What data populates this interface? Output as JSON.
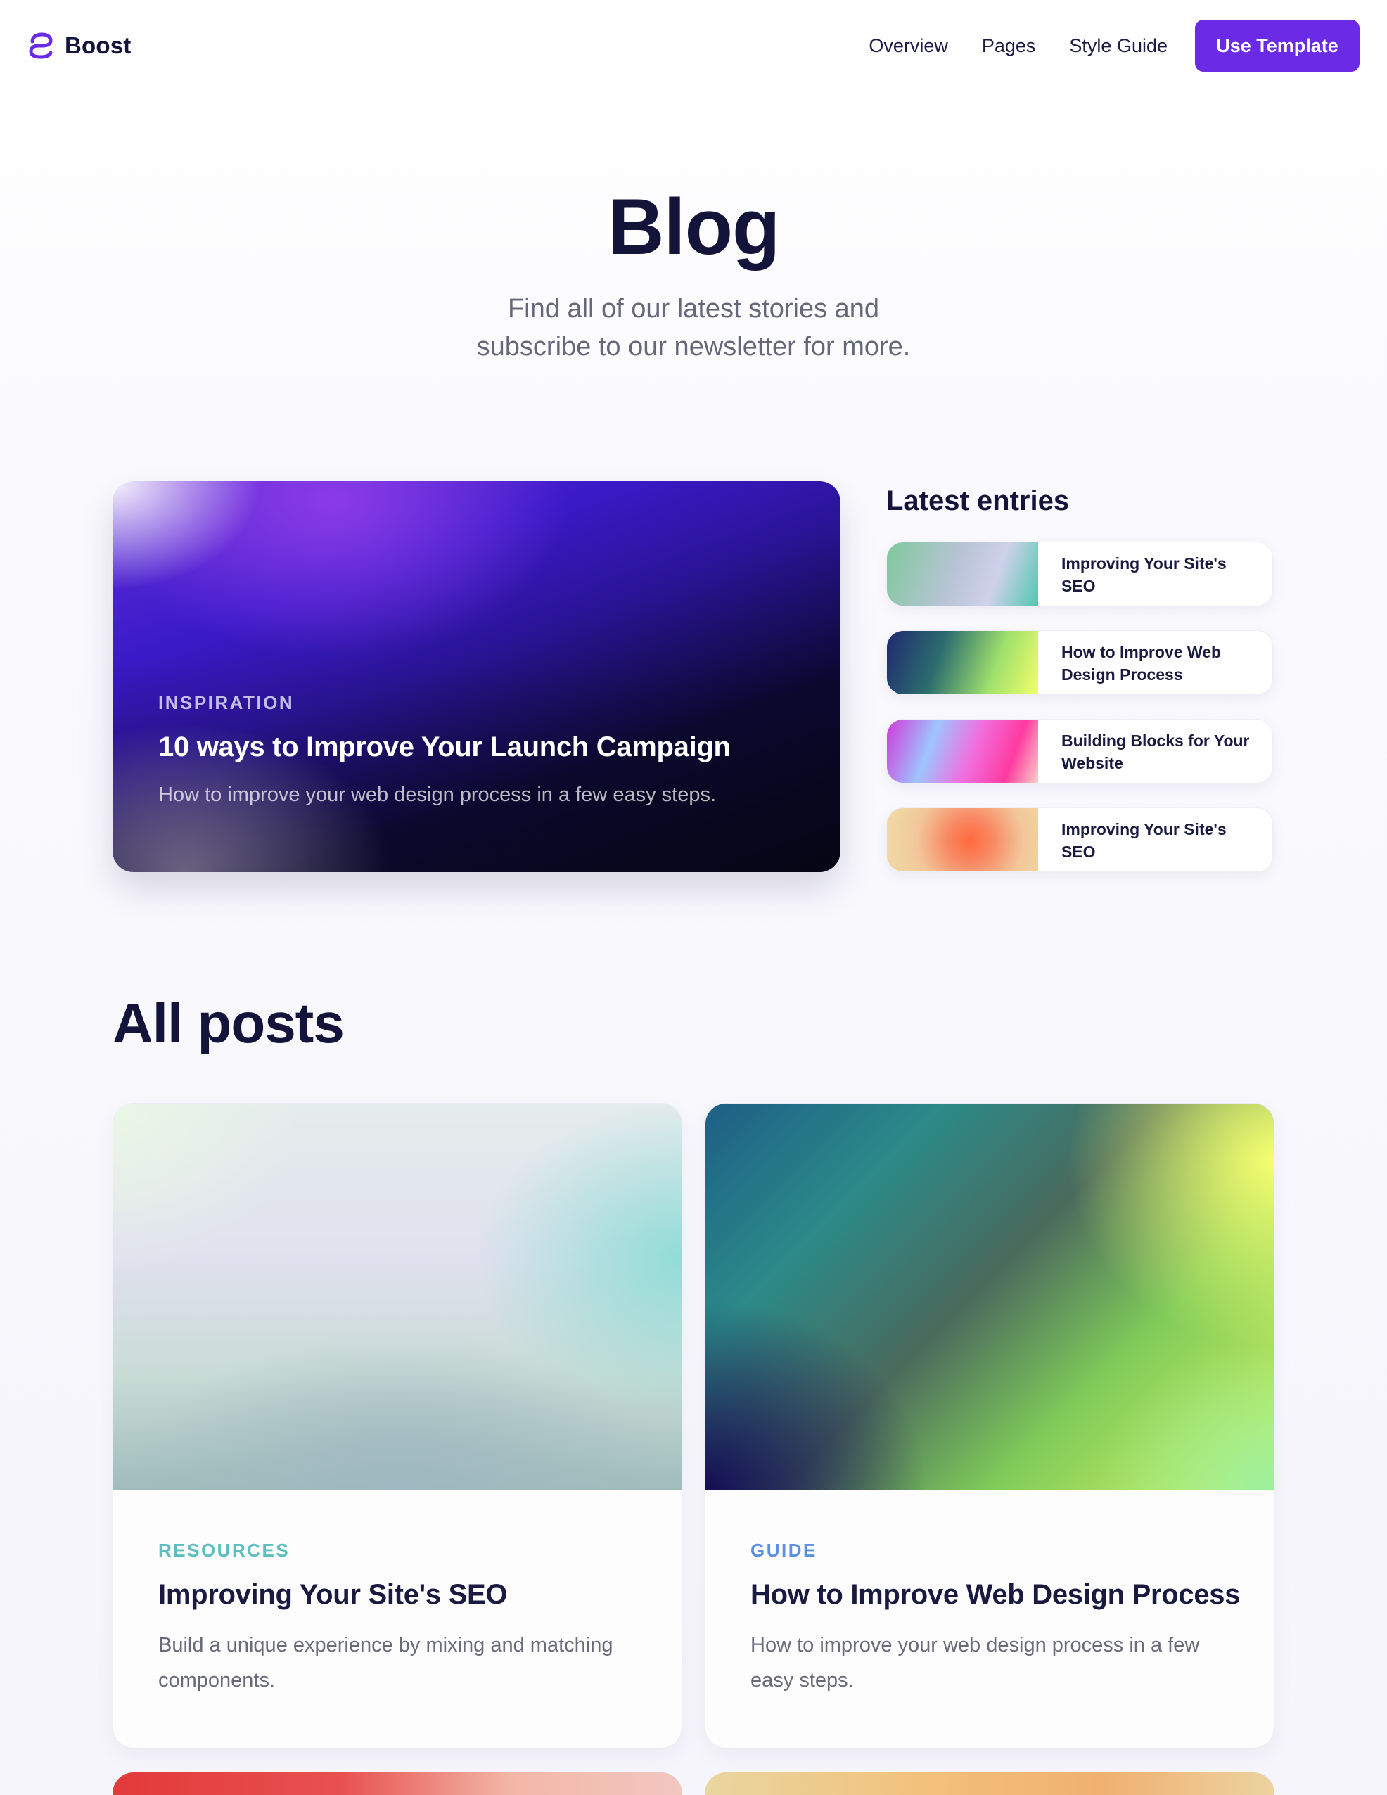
{
  "nav": {
    "brand": "Boost",
    "links": [
      "Overview",
      "Pages",
      "Style Guide"
    ],
    "cta": "Use Template"
  },
  "hero": {
    "title": "Blog",
    "subtitle_line1": "Find all of our latest stories and",
    "subtitle_line2": "subscribe to our newsletter for more."
  },
  "featured": {
    "category": "INSPIRATION",
    "title": "10 ways to Improve Your Launch Campaign",
    "description": "How to improve your web design process in a few easy steps."
  },
  "latest": {
    "heading": "Latest entries",
    "entries": [
      {
        "title_line1": "Improving Your Site's",
        "title_line2": "SEO"
      },
      {
        "title_line1": "How to Improve Web",
        "title_line2": "Design Process"
      },
      {
        "title_line1": "Building Blocks for Your",
        "title_line2": "Website"
      },
      {
        "title_line1": "Improving Your Site's",
        "title_line2": "SEO"
      }
    ]
  },
  "all_posts": {
    "heading": "All posts",
    "posts": [
      {
        "category": "RESOURCES",
        "category_color": "#5bbfc0",
        "title": "Improving Your Site's SEO",
        "description": "Build a unique experience by mixing and matching components."
      },
      {
        "category": "GUIDE",
        "category_color": "#5b8fe0",
        "title": "How to Improve Web Design Process",
        "description": "How to improve your web design process in a few easy steps."
      }
    ]
  },
  "colors": {
    "brand_accent": "#6b2be6",
    "heading_text": "#14133a"
  }
}
